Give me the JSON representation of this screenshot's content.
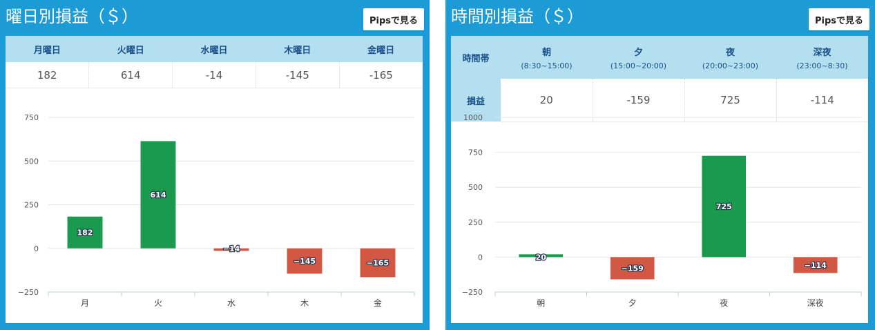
{
  "panels": {
    "weekday": {
      "title": "曜日別損益（＄）",
      "pips_button": "Pipsで見る",
      "table_headers": [
        "月曜日",
        "火曜日",
        "水曜日",
        "木曜日",
        "金曜日"
      ],
      "table_values": [
        "182",
        "614",
        "-14",
        "-145",
        "-165"
      ]
    },
    "time": {
      "title": "時間別損益（＄）",
      "pips_button": "Pipsで見る",
      "row_header_top": "時間帯",
      "row_header_bottom": "損益",
      "table_headers": [
        {
          "label": "朝",
          "range": "(8:30~15:00)"
        },
        {
          "label": "夕",
          "range": "(15:00~20:00)"
        },
        {
          "label": "夜",
          "range": "(20:00~23:00)"
        },
        {
          "label": "深夜",
          "range": "(23:00~8:30)"
        }
      ],
      "table_values": [
        "20",
        "-159",
        "725",
        "-114"
      ]
    }
  },
  "colors": {
    "panel_bg": "#1c9bd7",
    "header_bg": "#b3dff0",
    "positive": "#1a9a4c",
    "negative": "#d35843"
  },
  "chart_data": [
    {
      "type": "bar",
      "categories": [
        "月",
        "火",
        "水",
        "木",
        "金"
      ],
      "values": [
        182,
        614,
        -14,
        -145,
        -165
      ],
      "data_labels": [
        "182",
        "614",
        "-14",
        "-145",
        "-165"
      ],
      "ylim": [
        -250,
        750
      ],
      "yticks": [
        -250,
        0,
        250,
        500,
        750
      ],
      "grid": true,
      "positive_color": "#1a9a4c",
      "negative_color": "#d35843"
    },
    {
      "type": "bar",
      "categories": [
        "朝",
        "夕",
        "夜",
        "深夜"
      ],
      "values": [
        20,
        -159,
        725,
        -114
      ],
      "data_labels": [
        "20",
        "-159",
        "725",
        "-114"
      ],
      "ylim": [
        -250,
        1000
      ],
      "yticks": [
        -250,
        0,
        250,
        500,
        750,
        1000
      ],
      "grid": true,
      "positive_color": "#1a9a4c",
      "negative_color": "#d35843"
    }
  ]
}
